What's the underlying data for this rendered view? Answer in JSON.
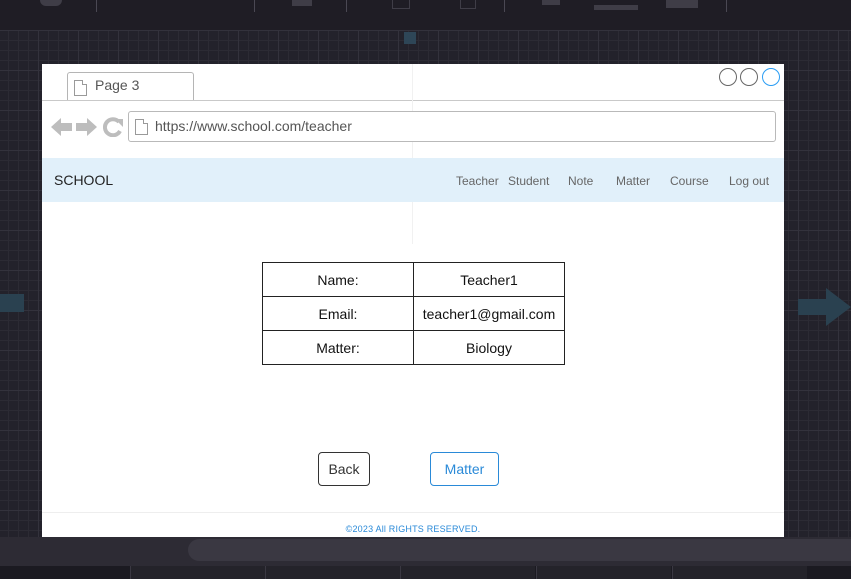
{
  "browser": {
    "tab_title": "Page 3",
    "url": "https://www.school.com/teacher"
  },
  "site": {
    "brand": "SCHOOL",
    "menu": [
      "Teacher",
      "Student",
      "Note",
      "Matter",
      "Course",
      "Log out"
    ]
  },
  "details": {
    "rows": [
      {
        "label": "Name:",
        "value": "Teacher1"
      },
      {
        "label": "Email:",
        "value": "teacher1@gmail.com"
      },
      {
        "label": "Matter:",
        "value": "Biology"
      }
    ]
  },
  "actions": {
    "back_label": "Back",
    "matter_label": "Matter"
  },
  "footer": {
    "copyright": "©2023 All RIGHTS RESERVED."
  },
  "colors": {
    "header_bg": "#e1f0fa",
    "accent": "#2a8ad8",
    "canvas_bg": "#23222b"
  },
  "icons": [
    "back-arrow-icon",
    "forward-arrow-icon",
    "reload-icon",
    "document-icon",
    "window-circle-icon"
  ]
}
